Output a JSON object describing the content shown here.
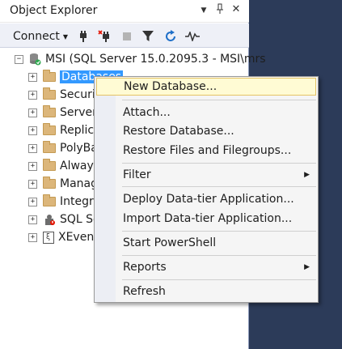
{
  "panel": {
    "title": "Object Explorer",
    "controls": {
      "dropdown": "▼",
      "pin": "⊓",
      "close": "✕"
    }
  },
  "toolbar": {
    "connect_label": "Connect",
    "icons": [
      "connect-icon",
      "disconnect-icon",
      "stop-icon",
      "filter-icon",
      "refresh-icon",
      "activity-monitor-icon"
    ]
  },
  "tree": {
    "server": "MSI (SQL Server 15.0.2095.3 - MSI\\mrs",
    "nodes": [
      {
        "label": "Databases",
        "selected": true
      },
      {
        "label": "Securit"
      },
      {
        "label": "Server"
      },
      {
        "label": "Replic"
      },
      {
        "label": "PolyBa"
      },
      {
        "label": "Always"
      },
      {
        "label": "Manag"
      },
      {
        "label": "Integra"
      },
      {
        "label": "SQL Se"
      },
      {
        "label": "XEvent"
      }
    ]
  },
  "context_menu": {
    "items": [
      {
        "label": "New Database...",
        "highlight": true
      },
      {
        "label": "Attach..."
      },
      {
        "label": "Restore Database..."
      },
      {
        "label": "Restore Files and Filegroups..."
      },
      {
        "label": "Filter",
        "submenu": true
      },
      {
        "label": "Deploy Data-tier Application..."
      },
      {
        "label": "Import Data-tier Application..."
      },
      {
        "label": "Start PowerShell"
      },
      {
        "label": "Reports",
        "submenu": true
      },
      {
        "label": "Refresh"
      }
    ]
  },
  "colors": {
    "selection": "#3399ff",
    "menu_highlight": "#fffbd4",
    "background": "#293955"
  }
}
